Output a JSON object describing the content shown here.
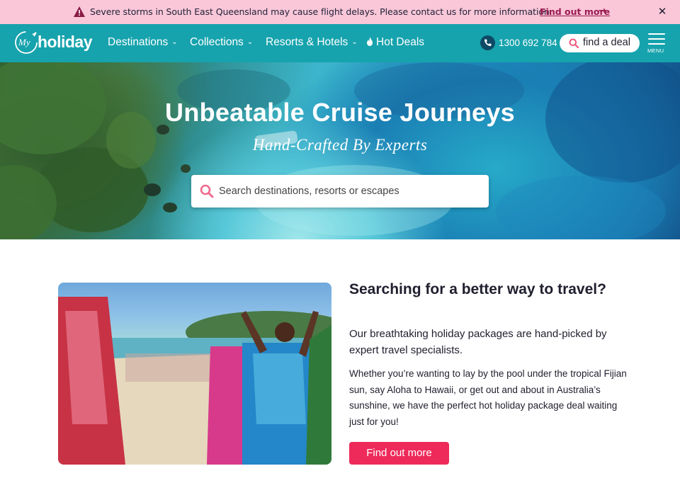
{
  "alert": {
    "message": "Severe storms in South East Queensland may cause flight delays. Please contact us for more information.",
    "link_label": "Find out more",
    "link_arrow": "→",
    "close_glyph": "✕",
    "icon": "warning-triangle-icon",
    "background_color": "#f9c7d8"
  },
  "header": {
    "logo_script": "My",
    "logo_word": "holiday",
    "nav": [
      {
        "label": "Destinations"
      },
      {
        "label": "Collections"
      },
      {
        "label": "Resorts & Hotels"
      },
      {
        "label": "Hot Deals",
        "icon": "flame-icon"
      }
    ],
    "phone": "1300 692 784",
    "deal_button": "find a deal",
    "menu_label": "MENU",
    "background_color": "#16a3ad"
  },
  "hero": {
    "title": "Unbeatable Cruise Journeys",
    "subtitle": "Hand-Crafted By Experts",
    "search_placeholder": "Search destinations, resorts or escapes"
  },
  "intro": {
    "title": "Searching for a better way to travel?",
    "lead": "Our breathtaking holiday packages are hand-picked by expert travel specialists.",
    "body": "Whether you’re wanting to lay by the pool under the tropical Fijian sun, say Aloha to Hawaii, or get out and about in Australia’s sunshine, we have the perfect hot holiday package deal waiting just for you!",
    "cta_label": "Find out more",
    "cta_color": "#ee2a5b"
  }
}
